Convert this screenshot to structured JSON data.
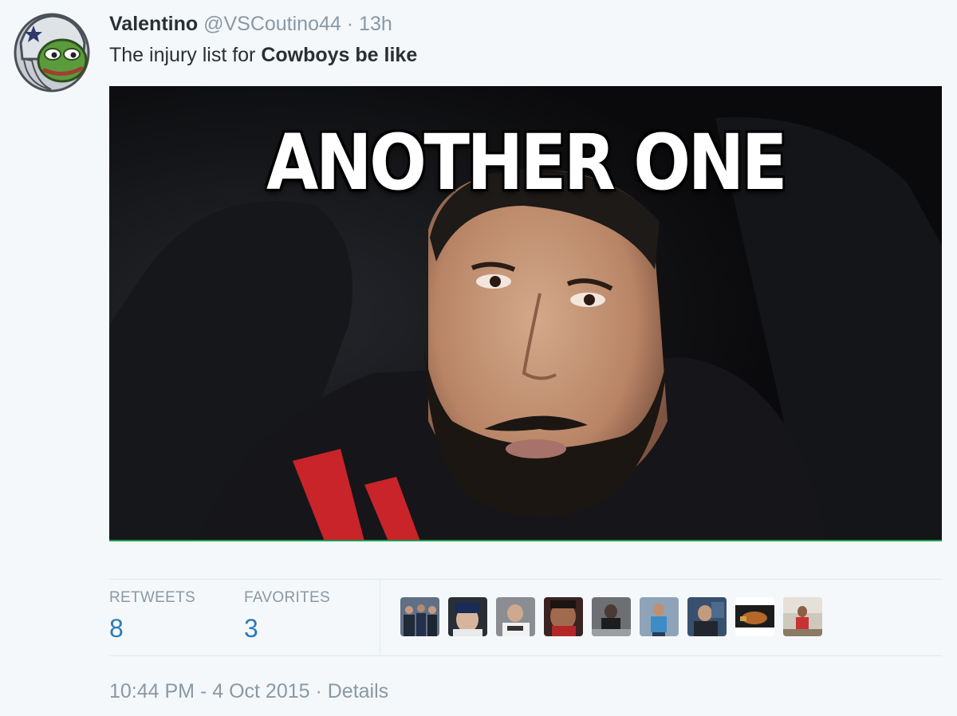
{
  "tweet": {
    "display_name": "Valentino",
    "handle": "@VSCoutino44",
    "separator": "·",
    "time_ago": "13h",
    "text_plain": "The injury list for ",
    "text_bold": "Cowboys be like",
    "media_caption": "ANOTHER ONE"
  },
  "stats": {
    "retweets_label": "RETWEETS",
    "retweets_value": "8",
    "favorites_label": "FAVORITES",
    "favorites_value": "3"
  },
  "footer": {
    "timestamp": "10:44 PM - 4 Oct 2015",
    "separator": " · ",
    "details_label": "Details"
  },
  "colors": {
    "link_blue": "#2b7bb9",
    "muted_gray": "#8899a6",
    "text_dark": "#292f33",
    "background": "#f5f8fa",
    "divider": "#e1e8ed"
  },
  "icons": {
    "avatar": "frog-avatar-icon"
  }
}
